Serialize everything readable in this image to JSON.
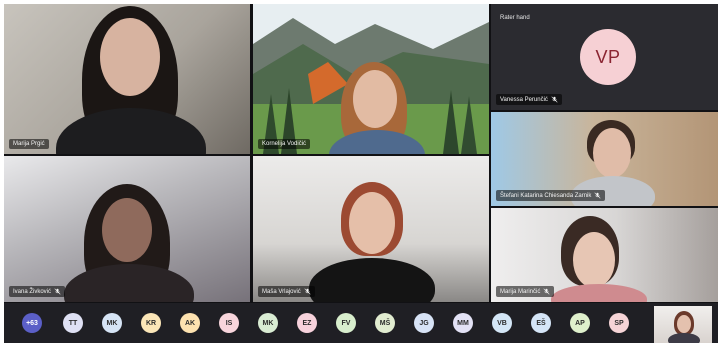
{
  "participants": [
    {
      "name": "Marija Prgić",
      "muted": false
    },
    {
      "name": "Kornelija Vodičić",
      "muted": false
    },
    {
      "name": "Vanessa Perunčić",
      "muted": true,
      "initials": "VP",
      "top_label": "Rater hand"
    },
    {
      "name": "Štefani Katarina Chiesanda Zarnik",
      "muted": true
    },
    {
      "name": "Ivana Živković",
      "muted": true
    },
    {
      "name": "Maša Vrlajović",
      "muted": true
    },
    {
      "name": "Marija Marinčić",
      "muted": true
    }
  ],
  "overflow_count": "+63",
  "roster": [
    {
      "initials": "TT",
      "color": "#dfe1f4"
    },
    {
      "initials": "MK",
      "color": "#d6e4f5"
    },
    {
      "initials": "KR",
      "color": "#fbe6b8"
    },
    {
      "initials": "AK",
      "color": "#fde2b0"
    },
    {
      "initials": "IS",
      "color": "#f8d5dc"
    },
    {
      "initials": "MK",
      "color": "#d9ecd3"
    },
    {
      "initials": "EZ",
      "color": "#f7d2dc"
    },
    {
      "initials": "FV",
      "color": "#d8eecd"
    },
    {
      "initials": "MŠ",
      "color": "#e1ecd0"
    },
    {
      "initials": "JG",
      "color": "#d7e3f6"
    },
    {
      "initials": "MM",
      "color": "#e3e2f5"
    },
    {
      "initials": "VB",
      "color": "#d4e6f6"
    },
    {
      "initials": "EŠ",
      "color": "#d5e5f7"
    },
    {
      "initials": "AP",
      "color": "#dff0cc"
    },
    {
      "initials": "SP",
      "color": "#f6d4d7"
    }
  ],
  "colors": {
    "accent": "#5b5fc7",
    "background": "#111114"
  }
}
